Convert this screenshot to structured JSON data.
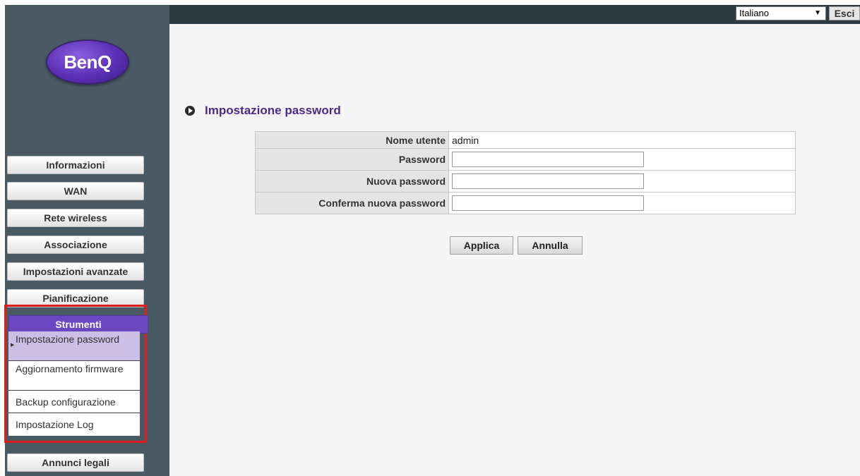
{
  "brand": {
    "logo_text": "BenQ"
  },
  "topbar": {
    "language_selected": "Italiano",
    "logout_label": "Esci"
  },
  "sidebar": {
    "items": [
      {
        "label": "Informazioni"
      },
      {
        "label": "WAN"
      },
      {
        "label": "Rete wireless"
      },
      {
        "label": "Associazione"
      },
      {
        "label": "Impostazioni avanzate"
      },
      {
        "label": "Pianificazione"
      },
      {
        "label": "Strumenti"
      },
      {
        "label": "Annunci legali"
      }
    ],
    "submenu": [
      {
        "label": "Impostazione password"
      },
      {
        "label": "Aggiornamento firmware"
      },
      {
        "label": "Backup configurazione"
      },
      {
        "label": "Impostazione Log"
      }
    ]
  },
  "main": {
    "title": "Impostazione password",
    "form": {
      "username_label": "Nome utente",
      "username_value": "admin",
      "password_label": "Password",
      "password_value": "",
      "new_password_label": "Nuova password",
      "new_password_value": "",
      "confirm_label": "Conferma nuova password",
      "confirm_value": ""
    },
    "apply_label": "Applica",
    "cancel_label": "Annulla"
  },
  "colors": {
    "accent": "#6b48c2",
    "highlight_border": "#e01e1e",
    "title": "#4b2a8a"
  }
}
